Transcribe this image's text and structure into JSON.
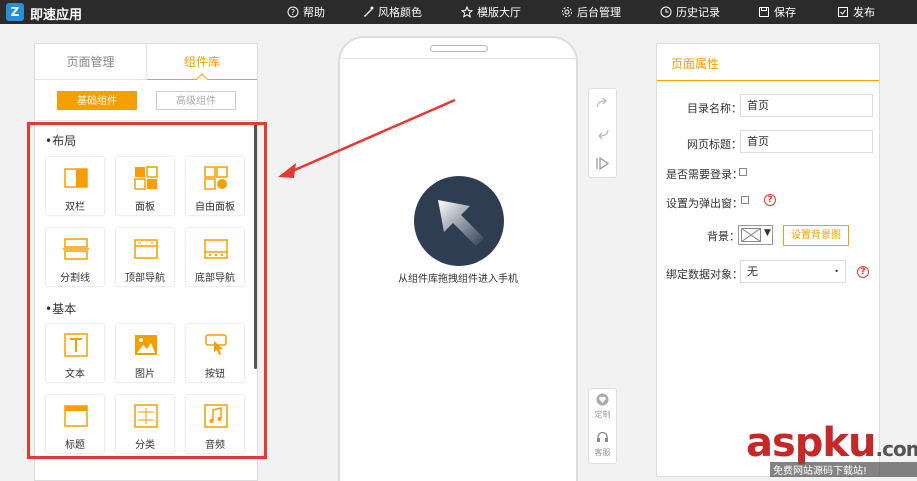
{
  "app": {
    "logo_letter": "Z",
    "title": "即速应用"
  },
  "nav": {
    "help": "帮助",
    "style_color": "风格颜色",
    "template_hall": "模版大厅",
    "admin": "后台管理",
    "history": "历史记录",
    "save": "保存",
    "publish": "发布"
  },
  "left_panel": {
    "tabs": [
      "页面管理",
      "组件库"
    ],
    "active_tab": "组件库",
    "sub_buttons": [
      "基础组件",
      "高级组件"
    ],
    "sections": [
      {
        "title": "•布局",
        "items": [
          "双栏",
          "面板",
          "自由面板",
          "分割线",
          "顶部导航",
          "底部导航"
        ]
      },
      {
        "title": "•基本",
        "items": [
          "文本",
          "图片",
          "按钮",
          "标题",
          "分类",
          "音频"
        ]
      }
    ]
  },
  "phone": {
    "hint": "从组件库拖拽组件进入手机"
  },
  "side_tools": {
    "customize": "定制",
    "service": "客服"
  },
  "properties": {
    "title": "页面属性",
    "dir_name_label": "目录名称：",
    "dir_name_value": "首页",
    "page_title_label": "网页标题：",
    "page_title_value": "首页",
    "need_login_label": "是否需要登录：",
    "popup_label": "设置为弹出窗：",
    "background_label": "背景：",
    "set_bg_button": "设置背景图",
    "bind_data_label": "绑定数据对象：",
    "bind_data_value": "无",
    "help_mark": "?"
  },
  "watermark": {
    "text": "aspku",
    "suffix": ".com",
    "sub": "免费网站源码下载站!"
  },
  "colors": {
    "accent": "#f5a000",
    "topbar": "#2b2b2b",
    "highlight": "#e53935"
  }
}
